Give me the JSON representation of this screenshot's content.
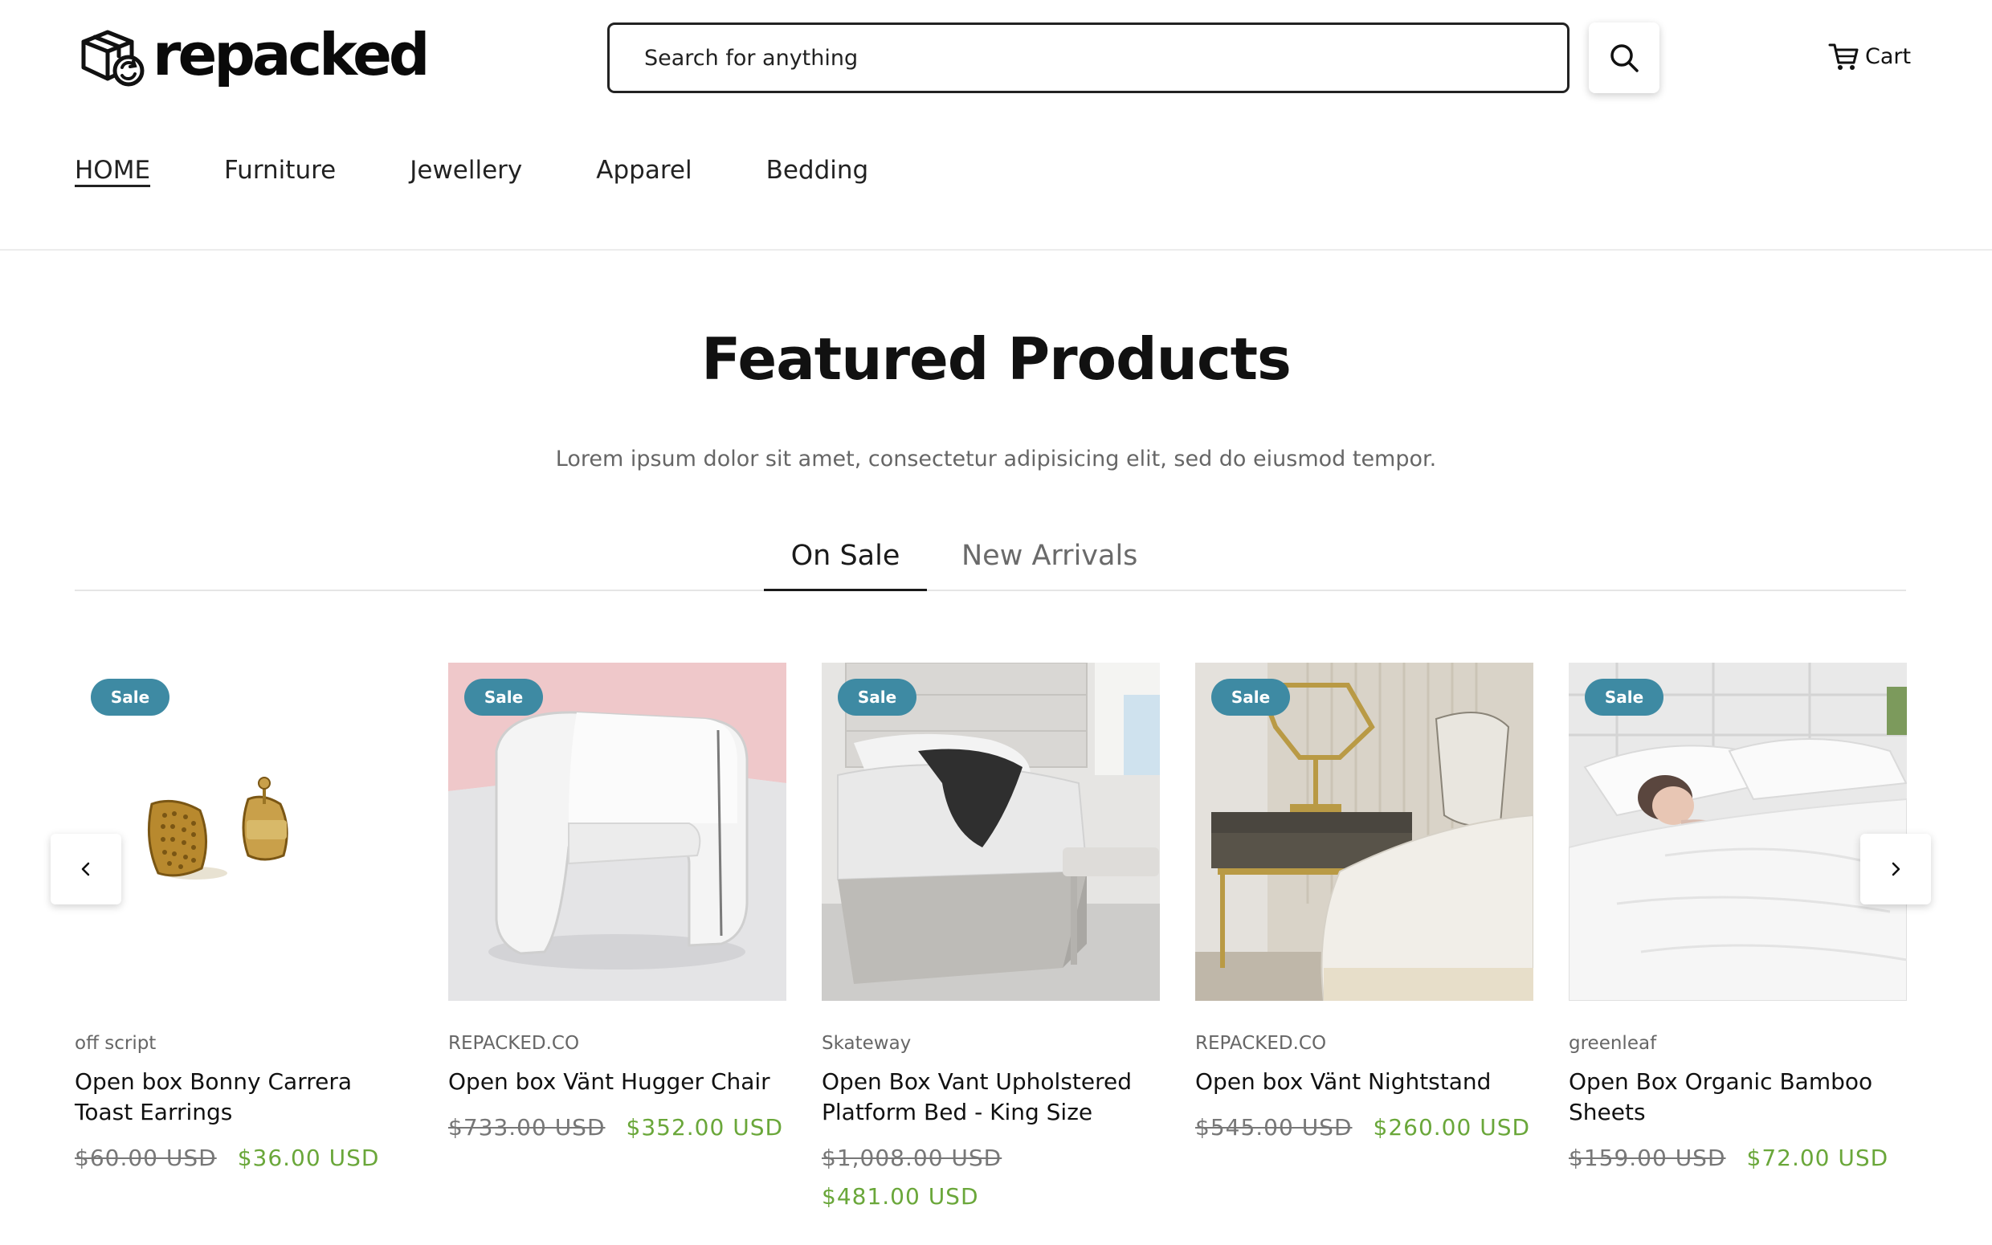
{
  "brand": {
    "name": "repacked",
    "logo_icon": "box-recycle-icon"
  },
  "search": {
    "placeholder": "Search for anything",
    "button_icon": "search-icon"
  },
  "cart": {
    "label": "Cart",
    "icon": "cart-icon"
  },
  "nav": {
    "items": [
      {
        "label": "HOME",
        "active": true
      },
      {
        "label": "Furniture"
      },
      {
        "label": "Jewellery"
      },
      {
        "label": "Apparel"
      },
      {
        "label": "Bedding"
      }
    ]
  },
  "featured": {
    "title": "Featured Products",
    "subtitle": "Lorem ipsum dolor sit amet, consectetur adipisicing elit, sed do eiusmod tempor.",
    "tabs": [
      {
        "label": "On Sale",
        "active": true
      },
      {
        "label": "New Arrivals"
      }
    ]
  },
  "carousel": {
    "prev_icon": "chevron-left-icon",
    "next_icon": "chevron-right-icon"
  },
  "products": [
    {
      "badge": "Sale",
      "vendor": "off script",
      "title": "Open box Bonny Carrera Toast Earrings",
      "old_price": "$60.00 USD",
      "price": "$36.00 USD",
      "image": "gold-earrings"
    },
    {
      "badge": "Sale",
      "vendor": "REPACKED.CO",
      "title": "Open box Vänt Hugger Chair",
      "old_price": "$733.00 USD",
      "price": "$352.00 USD",
      "image": "white-armchair"
    },
    {
      "badge": "Sale",
      "vendor": "Skateway",
      "title": "Open Box Vant Upholstered Platform Bed - King Size",
      "old_price": "$1,008.00 USD",
      "price": "$481.00 USD",
      "image": "grey-platform-bed"
    },
    {
      "badge": "Sale",
      "vendor": "REPACKED.CO",
      "title": "Open box Vänt Nightstand",
      "old_price": "$545.00 USD",
      "price": "$260.00 USD",
      "image": "nightstand-with-lamp"
    },
    {
      "badge": "Sale",
      "vendor": "greenleaf",
      "title": "Open Box Organic Bamboo Sheets",
      "old_price": "$159.00 USD",
      "price": "$72.00 USD",
      "image": "white-bamboo-sheets"
    }
  ],
  "colors": {
    "sale_badge": "#3e8aa3",
    "sale_price": "#6aa73a",
    "old_price": "#777777",
    "text": "#111111"
  }
}
